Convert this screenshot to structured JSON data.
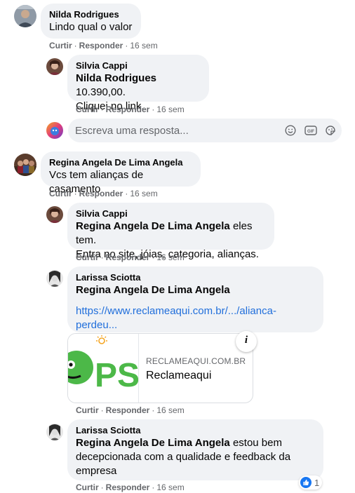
{
  "comments": [
    {
      "author": "Nilda Rodrigues",
      "text": "Lindo qual o valor",
      "actions": {
        "like": "Curtir",
        "reply": "Responder",
        "time": "16 sem"
      },
      "replies": [
        {
          "author": "Silvia Cappi",
          "mention": "Nilda Rodrigues",
          "text_line1": " 10.390,00.",
          "text_line2": "Cliquei no link.",
          "actions": {
            "like": "Curtir",
            "reply": "Responder",
            "time": "16 sem"
          }
        }
      ],
      "reply_box": {
        "placeholder": "Escreva uma resposta...",
        "icons": [
          "smile-icon",
          "gif-icon",
          "sticker-icon"
        ]
      }
    },
    {
      "author": "Regina Angela De Lima Angela",
      "text": "Vcs tem alianças de casamento",
      "actions": {
        "like": "Curtir",
        "reply": "Responder",
        "time": "16 sem"
      },
      "replies": [
        {
          "author": "Silvia Cappi",
          "mention": "Regina Angela De Lima Angela",
          "text_line1": " eles tem.",
          "text_line2": "Entra no site, jóias, categoria, alianças.",
          "actions": {
            "like": "Curtir",
            "reply": "Responder",
            "time": "16 sem"
          }
        },
        {
          "author": "Larissa Sciotta",
          "mention": "Regina Angela De Lima Angela",
          "link_line1": "https://www.reclameaqui.com.br/.../alianca-",
          "link_line2": "perdeu...",
          "preview": {
            "domain": "RECLAMEAQUI.COM.BR",
            "title": "Reclameaqui",
            "info": "i",
            "logo_text": "PS"
          },
          "actions": {
            "like": "Curtir",
            "reply": "Responder",
            "time": "16 sem"
          }
        },
        {
          "author": "Larissa Sciotta",
          "mention": "Regina Angela De Lima Angela",
          "text_line1": " estou bem",
          "text_line2": "decepcionada com a qualidade e feedback da",
          "text_line3": "empresa",
          "actions": {
            "like": "Curtir",
            "reply": "Responder",
            "time": "16 sem"
          },
          "reactions": {
            "icon": "like-icon",
            "count": "1"
          }
        }
      ]
    }
  ],
  "colors": {
    "bubble": "#f0f2f5",
    "meta": "#65676b",
    "link": "#216fdb",
    "like": "#1877f2",
    "logo_green": "#4cb848"
  }
}
